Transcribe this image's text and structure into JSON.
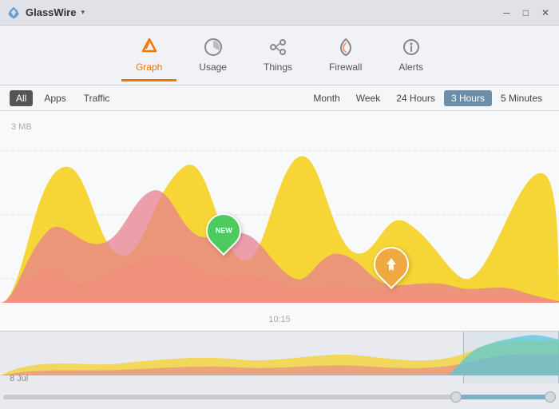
{
  "app": {
    "title": "GlassWire",
    "dropdown_label": "▾"
  },
  "titlebar": {
    "minimize": "─",
    "maximize": "□",
    "close": "✕"
  },
  "nav": {
    "items": [
      {
        "id": "graph",
        "label": "Graph",
        "active": true
      },
      {
        "id": "usage",
        "label": "Usage",
        "active": false
      },
      {
        "id": "things",
        "label": "Things",
        "active": false
      },
      {
        "id": "firewall",
        "label": "Firewall",
        "active": false
      },
      {
        "id": "alerts",
        "label": "Alerts",
        "active": false
      }
    ]
  },
  "filters": {
    "view_buttons": [
      {
        "label": "All",
        "active": true
      },
      {
        "label": "Apps",
        "active": false
      },
      {
        "label": "Traffic",
        "active": false
      }
    ],
    "time_buttons": [
      {
        "label": "Month",
        "active": false
      },
      {
        "label": "Week",
        "active": false
      },
      {
        "label": "24 Hours",
        "active": false
      },
      {
        "label": "3 Hours",
        "active": true
      },
      {
        "label": "5 Minutes",
        "active": false
      }
    ]
  },
  "chart": {
    "y_label": "3 MB",
    "x_label": "10:15"
  },
  "pins": [
    {
      "type": "new",
      "label": "NEW"
    },
    {
      "type": "orange",
      "label": ""
    }
  ],
  "minimap": {
    "date_label": "8 Jul"
  }
}
